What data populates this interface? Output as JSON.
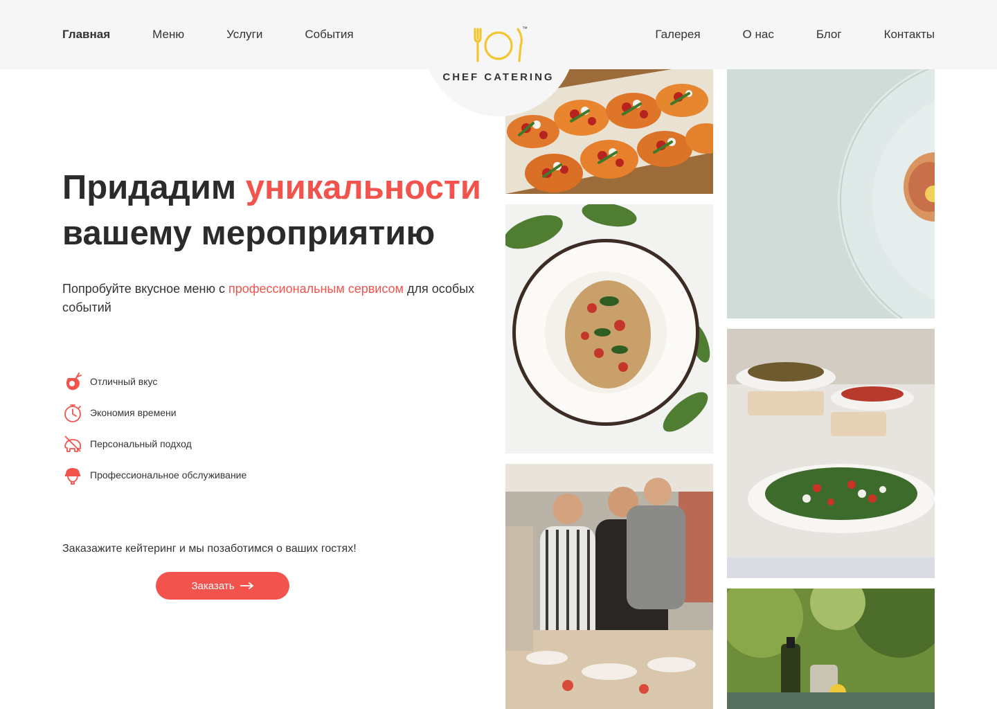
{
  "nav": {
    "left": [
      {
        "label": "Главная",
        "active": true
      },
      {
        "label": "Меню"
      },
      {
        "label": "Услуги"
      },
      {
        "label": "События"
      }
    ],
    "right": [
      {
        "label": "Галерея"
      },
      {
        "label": "О нас"
      },
      {
        "label": "Блог"
      },
      {
        "label": "Контакты"
      }
    ]
  },
  "logo": {
    "text": "CHEF CATERING",
    "tm": "™"
  },
  "hero": {
    "title_part1": "Придадим ",
    "title_accent": "уникальности",
    "title_part2": "вашему мероприятию",
    "subtitle_part1": "Попробуйте вкусное меню с ",
    "subtitle_accent": "профессиональным сервисом",
    "subtitle_part2": " для особых событий"
  },
  "features": [
    {
      "icon": "taste-icon",
      "label": "Отличный вкус"
    },
    {
      "icon": "stopwatch-icon",
      "label": "Экономия времени"
    },
    {
      "icon": "personal-icon",
      "label": "Персональный подход"
    },
    {
      "icon": "chef-hat-icon",
      "label": "Профессиональное обслуживание"
    }
  ],
  "cta": {
    "text": "Заказажите кейтеринг и мы позаботимся о ваших гостях!",
    "button_label": "Заказать"
  },
  "gallery": [
    {
      "name": "photo-bruschetta"
    },
    {
      "name": "photo-plate-closeup"
    },
    {
      "name": "photo-pasta-bowl"
    },
    {
      "name": "photo-buffet-salads"
    },
    {
      "name": "photo-guests-buffet"
    },
    {
      "name": "photo-olive-oil"
    }
  ],
  "colors": {
    "accent": "#f2534d",
    "logo_gold": "#f2c531",
    "header_bg": "#f6f6f6",
    "text": "#2b2b2b"
  }
}
